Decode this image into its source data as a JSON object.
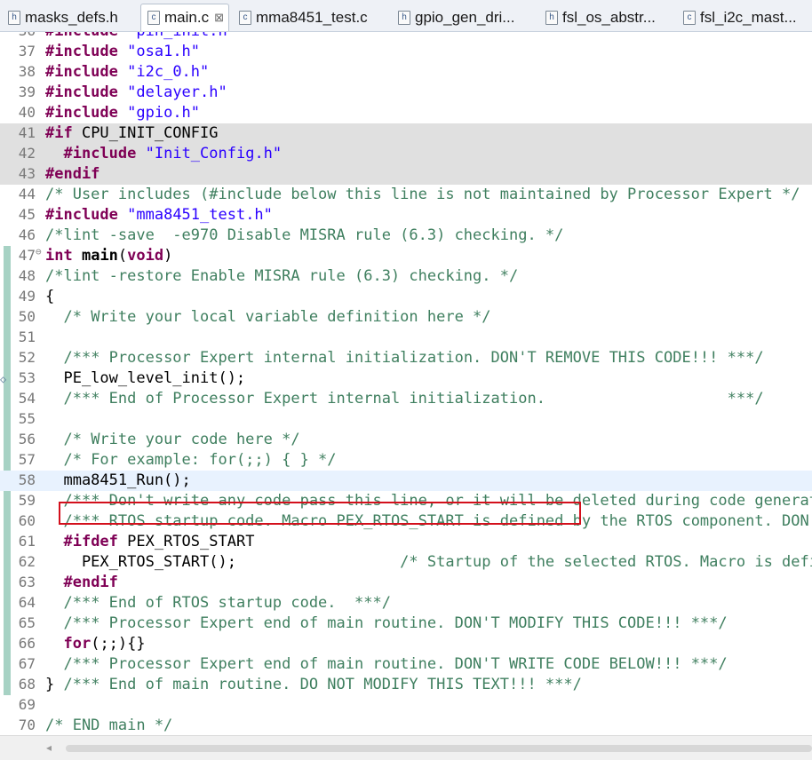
{
  "tabs": [
    {
      "label": "masks_defs.h",
      "type": "h",
      "active": false
    },
    {
      "label": "main.c",
      "type": "c",
      "active": true,
      "close": "⊠"
    },
    {
      "label": "mma8451_test.c",
      "type": "c",
      "active": false
    },
    {
      "label": "gpio_gen_dri...",
      "type": "h",
      "active": false
    },
    {
      "label": "fsl_os_abstr...",
      "type": "h",
      "active": false
    },
    {
      "label": "fsl_i2c_mast...",
      "type": "c",
      "active": false
    }
  ],
  "code_lines": [
    {
      "num": "36",
      "tokens": [
        [
          "kw",
          "#include"
        ],
        [
          "",
          " "
        ],
        [
          "str",
          "\"pin_init.h\""
        ]
      ]
    },
    {
      "num": "37",
      "tokens": [
        [
          "kw",
          "#include"
        ],
        [
          "",
          " "
        ],
        [
          "str",
          "\"osa1.h\""
        ]
      ]
    },
    {
      "num": "38",
      "tokens": [
        [
          "kw",
          "#include"
        ],
        [
          "",
          " "
        ],
        [
          "str",
          "\"i2c_0.h\""
        ]
      ]
    },
    {
      "num": "39",
      "tokens": [
        [
          "kw",
          "#include"
        ],
        [
          "",
          " "
        ],
        [
          "str",
          "\"delayer.h\""
        ]
      ]
    },
    {
      "num": "40",
      "tokens": [
        [
          "kw",
          "#include"
        ],
        [
          "",
          " "
        ],
        [
          "str",
          "\"gpio.h\""
        ]
      ]
    },
    {
      "num": "41",
      "bg": "cond",
      "tokens": [
        [
          "kw",
          "#if"
        ],
        [
          "",
          " CPU_INIT_CONFIG"
        ]
      ]
    },
    {
      "num": "42",
      "bg": "cond",
      "tokens": [
        [
          "",
          "  "
        ],
        [
          "kw",
          "#include"
        ],
        [
          "",
          " "
        ],
        [
          "str",
          "\"Init_Config.h\""
        ]
      ]
    },
    {
      "num": "43",
      "bg": "cond",
      "tokens": [
        [
          "kw",
          "#endif"
        ]
      ]
    },
    {
      "num": "44",
      "tokens": [
        [
          "cm",
          "/* User includes (#include below this line is not maintained by Processor Expert */"
        ]
      ]
    },
    {
      "num": "45",
      "tokens": [
        [
          "kw",
          "#include"
        ],
        [
          "",
          " "
        ],
        [
          "str",
          "\"mma8451_test.h\""
        ]
      ]
    },
    {
      "num": "46",
      "tokens": [
        [
          "cm",
          "/*lint -save  -e970 Disable MISRA rule (6.3) checking. */"
        ]
      ]
    },
    {
      "num": "47",
      "fold": "⊖",
      "tokens": [
        [
          "kw",
          "int"
        ],
        [
          "",
          " "
        ],
        [
          "fn",
          "main"
        ],
        [
          "",
          "("
        ],
        [
          "kw",
          "void"
        ],
        [
          "",
          ")"
        ]
      ]
    },
    {
      "num": "48",
      "tokens": [
        [
          "cm",
          "/*lint -restore Enable MISRA rule (6.3) checking. */"
        ]
      ]
    },
    {
      "num": "49",
      "tokens": [
        [
          "",
          "{"
        ]
      ]
    },
    {
      "num": "50",
      "tokens": [
        [
          "",
          "  "
        ],
        [
          "cm",
          "/* Write your local variable definition here */"
        ]
      ]
    },
    {
      "num": "51",
      "tokens": []
    },
    {
      "num": "52",
      "tokens": [
        [
          "",
          "  "
        ],
        [
          "cm",
          "/*** Processor Expert internal initialization. DON'T REMOVE THIS CODE!!! ***/"
        ]
      ]
    },
    {
      "num": "53",
      "mark": "◇",
      "tokens": [
        [
          "",
          "  PE_low_level_init();"
        ]
      ]
    },
    {
      "num": "54",
      "tokens": [
        [
          "",
          "  "
        ],
        [
          "cm",
          "/*** End of Processor Expert internal initialization.                    ***/"
        ]
      ]
    },
    {
      "num": "55",
      "tokens": []
    },
    {
      "num": "56",
      "tokens": [
        [
          "",
          "  "
        ],
        [
          "cm",
          "/* Write your code here */"
        ]
      ]
    },
    {
      "num": "57",
      "tokens": [
        [
          "",
          "  "
        ],
        [
          "cm",
          "/* For example: for(;;) { } */"
        ]
      ]
    },
    {
      "num": "58",
      "bg": "cur",
      "tokens": [
        [
          "",
          "  mma8451_Run();"
        ]
      ]
    },
    {
      "num": "59",
      "tokens": [
        [
          "",
          "  "
        ],
        [
          "cm",
          "/*** Don't write any code pass this line, or it will be deleted during code generation. ***/"
        ]
      ]
    },
    {
      "num": "60",
      "tokens": [
        [
          "",
          "  "
        ],
        [
          "cm",
          "/*** RTOS startup code. Macro PEX_RTOS_START is defined by the RTOS component. DON'T MODIFY THIS CODE!!! ***/"
        ]
      ]
    },
    {
      "num": "61",
      "tokens": [
        [
          "",
          "  "
        ],
        [
          "kw",
          "#ifdef"
        ],
        [
          "",
          " PEX_RTOS_START"
        ]
      ]
    },
    {
      "num": "62",
      "tokens": [
        [
          "",
          "    PEX_RTOS_START();                  "
        ],
        [
          "cm",
          "/* Startup of the selected RTOS. Macro is defined by the RTOS component. */"
        ]
      ]
    },
    {
      "num": "63",
      "tokens": [
        [
          "",
          "  "
        ],
        [
          "kw",
          "#endif"
        ]
      ]
    },
    {
      "num": "64",
      "tokens": [
        [
          "",
          "  "
        ],
        [
          "cm",
          "/*** End of RTOS startup code.  ***/"
        ]
      ]
    },
    {
      "num": "65",
      "tokens": [
        [
          "",
          "  "
        ],
        [
          "cm",
          "/*** Processor Expert end of main routine. DON'T MODIFY THIS CODE!!! ***/"
        ]
      ]
    },
    {
      "num": "66",
      "tokens": [
        [
          "",
          "  "
        ],
        [
          "kw",
          "for"
        ],
        [
          "",
          "(;;){}"
        ]
      ]
    },
    {
      "num": "67",
      "tokens": [
        [
          "",
          "  "
        ],
        [
          "cm",
          "/*** Processor Expert end of main routine. DON'T WRITE CODE BELOW!!! ***/"
        ]
      ]
    },
    {
      "num": "68",
      "tokens": [
        [
          "",
          "} "
        ],
        [
          "cm",
          "/*** End of main routine. DO NOT MODIFY THIS TEXT!!! ***/"
        ]
      ]
    },
    {
      "num": "69",
      "tokens": []
    },
    {
      "num": "70",
      "tokens": [
        [
          "cm",
          "/* END main */"
        ]
      ]
    }
  ],
  "scroll": {
    "left_arrow": "◂"
  },
  "colors": {
    "keyword": "#7f0055",
    "string": "#2a00ff",
    "comment": "#3f7f5f",
    "highlight_box": "#d3101c"
  }
}
